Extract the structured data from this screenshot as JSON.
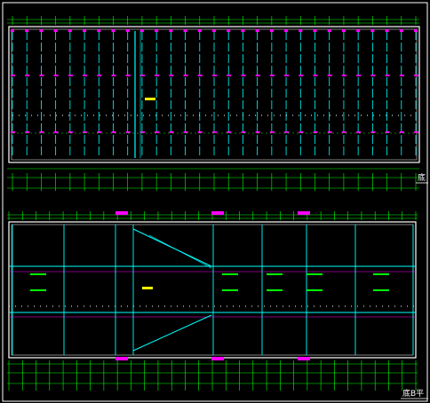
{
  "drawing": {
    "background": "#000000",
    "colors": {
      "frame": "#ffffff",
      "wall": "#ffffff",
      "beam": "#00ffff",
      "dim": "#00ff00",
      "tag": "#ff00ff",
      "note": "#ffff00"
    },
    "upper_plan": {
      "label": "底",
      "note": "───"
    },
    "lower_plan": {
      "label": "底B平",
      "note": "───"
    }
  }
}
